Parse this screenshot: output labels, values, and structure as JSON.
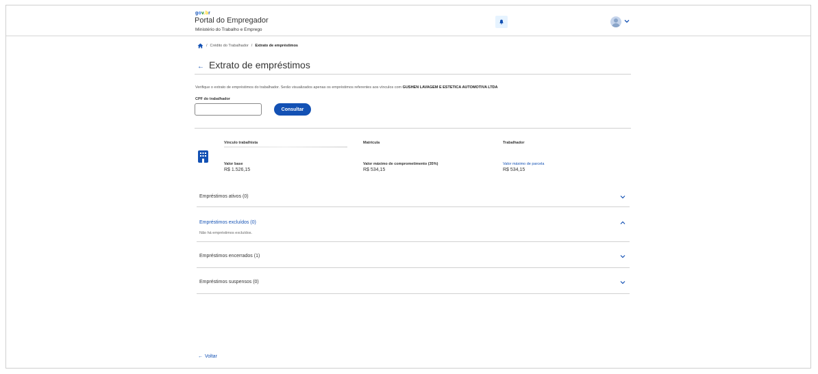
{
  "header": {
    "logo": {
      "g": "g",
      "o": "o",
      "v": "v",
      "b": ".b",
      "r": "r"
    },
    "title": "Portal do Empregador",
    "subtitle": "Ministério do Trabalho e Emprego"
  },
  "breadcrumb": {
    "items": [
      "Crédito do Trabalhador",
      "Extrato de empréstimos"
    ],
    "separator": "/"
  },
  "page": {
    "back_glyph": "←",
    "title": "Extrato de empréstimos",
    "description_prefix": "Verifique o extrato de empréstimos do trabalhador. Serão visualizados apenas os empréstimos referentes aos vínculos com",
    "description_company": "GUSHEN LAVAGEM E ESTETICA AUTOMOTIVA LTDA",
    "cpf_label": "CPF do trabalhador",
    "cpf_value": "",
    "consultar_label": "Consultar"
  },
  "info": {
    "vinculo_label": "Vínculo trabalhista",
    "matricula_label": "Matrícula",
    "trabalhador_label": "Trabalhador",
    "valor_base_label": "Valor base",
    "valor_base": "R$ 1.526,15",
    "valor_maximo_label": "Valor máximo de comprometimento (35%)",
    "valor_maximo": "R$ 534,15",
    "parcela_label": "Valor máximo de parcela",
    "parcela": "R$ 534,15"
  },
  "accordions": [
    {
      "title": "Empréstimos ativos (0)",
      "open": false
    },
    {
      "title": "Empréstimos excluídos (0)",
      "open": true,
      "empty_text": "Não há empréstimos excluídos."
    },
    {
      "title": "Empréstimos encerrados (1)",
      "open": false
    },
    {
      "title": "Empréstimos suspensos (0)",
      "open": false
    }
  ],
  "footer": {
    "voltar_label": "Voltar"
  },
  "colors": {
    "primary": "#1351b4",
    "bell_bg": "#e6f3ff"
  }
}
